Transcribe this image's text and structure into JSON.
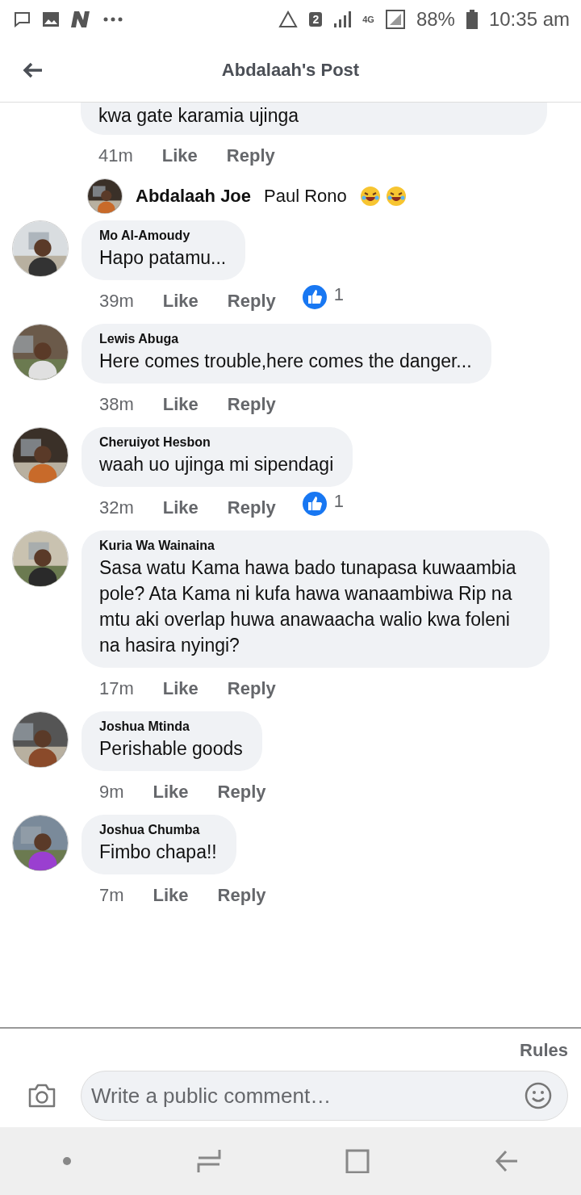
{
  "status_bar": {
    "sim_badge": "2",
    "network": "4G",
    "battery": "88%",
    "time": "10:35 am"
  },
  "header": {
    "title": "Abdalaah's Post"
  },
  "comments": [
    {
      "kind": "cut",
      "text": "kwa gate karamia ujinga",
      "time": "41m",
      "like": "Like",
      "reply": "Reply"
    },
    {
      "kind": "reply",
      "author": "Abdalaah Joe",
      "text": "Paul Rono"
    },
    {
      "kind": "comment",
      "author": "Mo Al-Amoudy",
      "text": "Hapo patamu...",
      "time": "39m",
      "like": "Like",
      "reply": "Reply",
      "likes": "1"
    },
    {
      "kind": "comment",
      "author": "Lewis Abuga",
      "text": "Here comes trouble,here comes the danger...",
      "time": "38m",
      "like": "Like",
      "reply": "Reply"
    },
    {
      "kind": "comment",
      "author": "Cheruiyot Hesbon",
      "text": "waah uo ujinga mi sipendagi",
      "time": "32m",
      "like": "Like",
      "reply": "Reply",
      "likes": "1"
    },
    {
      "kind": "comment",
      "author": "Kuria Wa Wainaina",
      "text": "Sasa watu Kama hawa bado tunapasa kuwaambia pole? Ata Kama ni kufa hawa wanaambiwa Rip na mtu aki overlap huwa anawaacha walio kwa foleni na hasira nyingi?",
      "time": "17m",
      "like": "Like",
      "reply": "Reply"
    },
    {
      "kind": "comment",
      "author": "Joshua Mtinda",
      "text": "Perishable goods",
      "time": "9m",
      "like": "Like",
      "reply": "Reply"
    },
    {
      "kind": "comment",
      "author": "Joshua Chumba",
      "text": "Fimbo chapa!!",
      "time": "7m",
      "like": "Like",
      "reply": "Reply"
    }
  ],
  "rules": "Rules",
  "composer": {
    "placeholder": "Write a public comment…"
  }
}
